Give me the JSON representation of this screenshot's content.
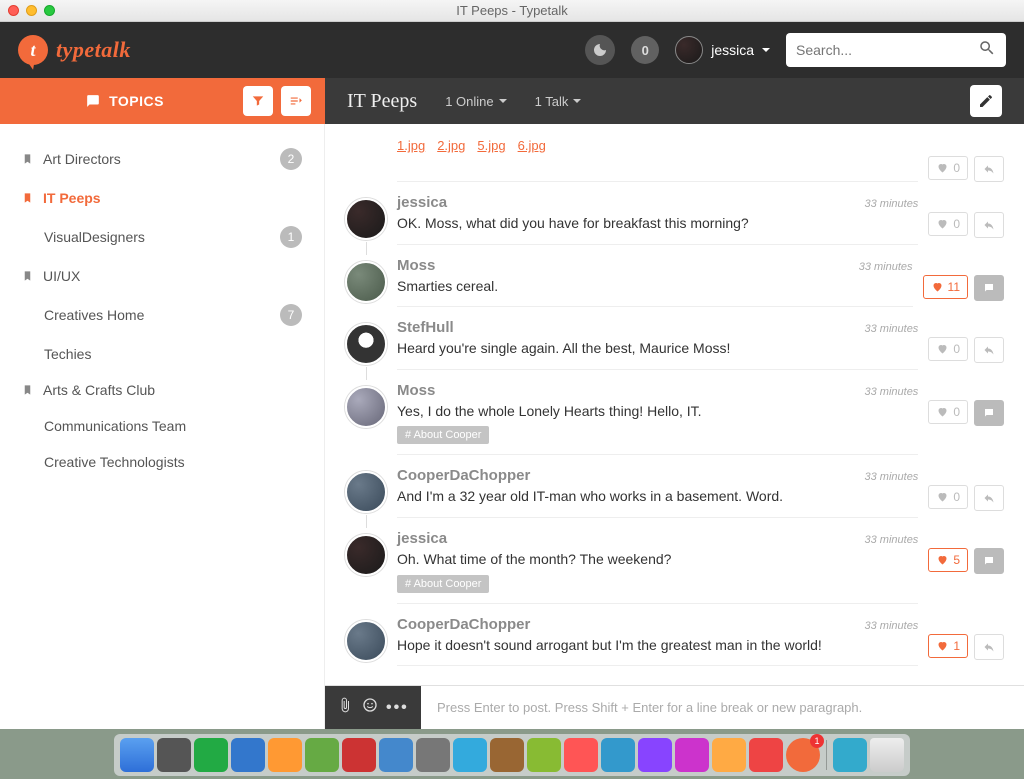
{
  "window": {
    "title": "IT Peeps - Typetalk"
  },
  "brand": {
    "name": "typetalk",
    "initial": "t"
  },
  "header": {
    "notif_count": "0",
    "user_name": "jessica",
    "search_placeholder": "Search..."
  },
  "sidebar": {
    "topics_label": "TOPICS",
    "items": [
      {
        "label": "Art Directors",
        "badge": "2",
        "bookmarked": true,
        "active": false,
        "indented": false
      },
      {
        "label": "IT Peeps",
        "badge": "",
        "bookmarked": true,
        "active": true,
        "indented": false
      },
      {
        "label": "VisualDesigners",
        "badge": "1",
        "bookmarked": false,
        "active": false,
        "indented": true
      },
      {
        "label": "UI/UX",
        "badge": "",
        "bookmarked": true,
        "active": false,
        "indented": false
      },
      {
        "label": "Creatives Home",
        "badge": "7",
        "bookmarked": false,
        "active": false,
        "indented": true
      },
      {
        "label": "Techies",
        "badge": "",
        "bookmarked": false,
        "active": false,
        "indented": true
      },
      {
        "label": "Arts & Crafts Club",
        "badge": "",
        "bookmarked": true,
        "active": false,
        "indented": false
      },
      {
        "label": "Communications Team",
        "badge": "",
        "bookmarked": false,
        "active": false,
        "indented": true
      },
      {
        "label": "Creative Technologists",
        "badge": "",
        "bookmarked": false,
        "active": false,
        "indented": true
      }
    ]
  },
  "conversation": {
    "title": "IT Peeps",
    "online_label": "1 Online",
    "talk_label": "1 Talk",
    "attachments_row": [
      "1.jpg",
      "2.jpg",
      "5.jpg",
      "6.jpg"
    ],
    "messages": [
      {
        "user": "jessica",
        "text": "OK. Moss, what did you have for breakfast this morning?",
        "time": "33 minutes",
        "likes": "0",
        "liked": false,
        "tag": "",
        "avatar": "av-jessica",
        "reply_filled": false,
        "thread": true
      },
      {
        "user": "Moss",
        "text": "Smarties cereal.",
        "time": "33 minutes",
        "likes": "11",
        "liked": true,
        "tag": "",
        "avatar": "av-moss",
        "reply_filled": true,
        "thread": false
      },
      {
        "user": "StefHull",
        "text": "Heard you're single again. All the best, Maurice Moss!",
        "time": "33 minutes",
        "likes": "0",
        "liked": false,
        "tag": "",
        "avatar": "av-stef",
        "reply_filled": false,
        "thread": true
      },
      {
        "user": "Moss",
        "text": "Yes, I do the whole Lonely Hearts thing! Hello, IT.",
        "time": "33 minutes",
        "likes": "0",
        "liked": false,
        "tag": "# About Cooper",
        "avatar": "av-moss2",
        "reply_filled": true,
        "thread": false
      },
      {
        "user": "CooperDaChopper",
        "text": "And I'm a 32 year old IT-man who works in a basement. Word.",
        "time": "33 minutes",
        "likes": "0",
        "liked": false,
        "tag": "",
        "avatar": "av-cooper",
        "reply_filled": false,
        "thread": true
      },
      {
        "user": "jessica",
        "text": "Oh. What time of the month? The weekend?",
        "time": "33 minutes",
        "likes": "5",
        "liked": true,
        "tag": "# About Cooper",
        "avatar": "av-jessica",
        "reply_filled": true,
        "thread": false
      },
      {
        "user": "CooperDaChopper",
        "text": "Hope it doesn't sound arrogant but I'm the greatest man in the world!",
        "time": "33 minutes",
        "likes": "1",
        "liked": true,
        "tag": "",
        "avatar": "av-cooper",
        "reply_filled": false,
        "thread": false
      }
    ]
  },
  "composer": {
    "placeholder": "Press Enter to post. Press Shift + Enter for a line break or new paragraph."
  },
  "colors": {
    "accent": "#f26a3b"
  }
}
